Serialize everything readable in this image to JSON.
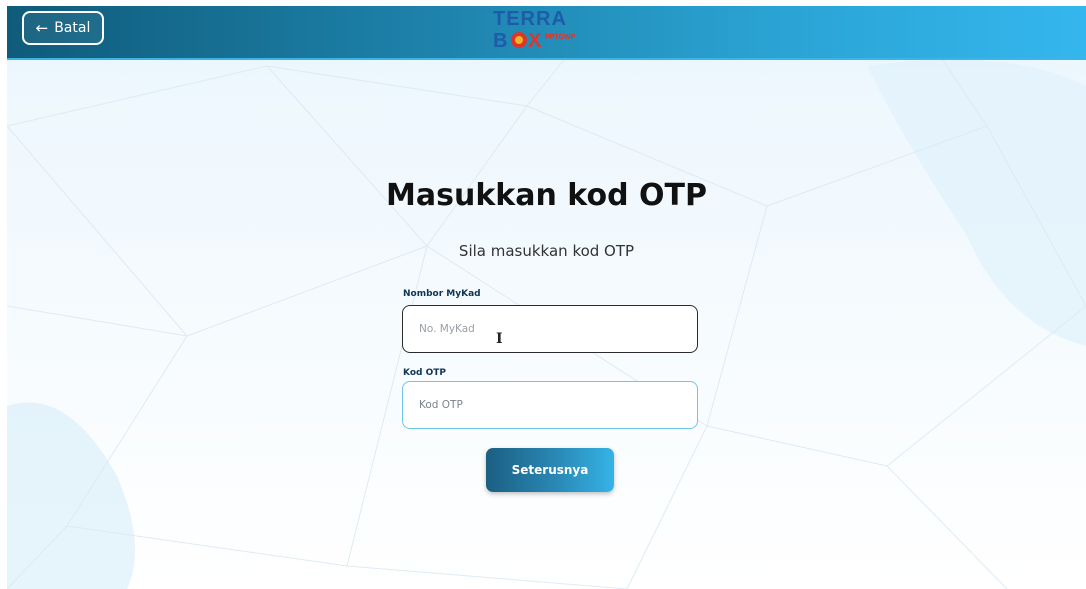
{
  "header": {
    "back_label": "Batal",
    "logo": {
      "line1": "TERRA",
      "line2_o": "B",
      "line2_x": "X",
      "tagline": "PPTGWP"
    }
  },
  "main": {
    "title": "Masukkan kod OTP",
    "subtitle": "Sila masukkan kod OTP",
    "mykad_label": "Nombor MyKad",
    "mykad_placeholder": "No. MyKad",
    "otp_label": "Kod OTP",
    "otp_placeholder": "Kod OTP",
    "next_label": "Seterusnya"
  },
  "colors": {
    "header_start": "#0f5b7a",
    "header_end": "#34b7ee",
    "label": "#0e3557",
    "logo_blue": "#1e5ba8",
    "logo_red": "#e0342b"
  }
}
